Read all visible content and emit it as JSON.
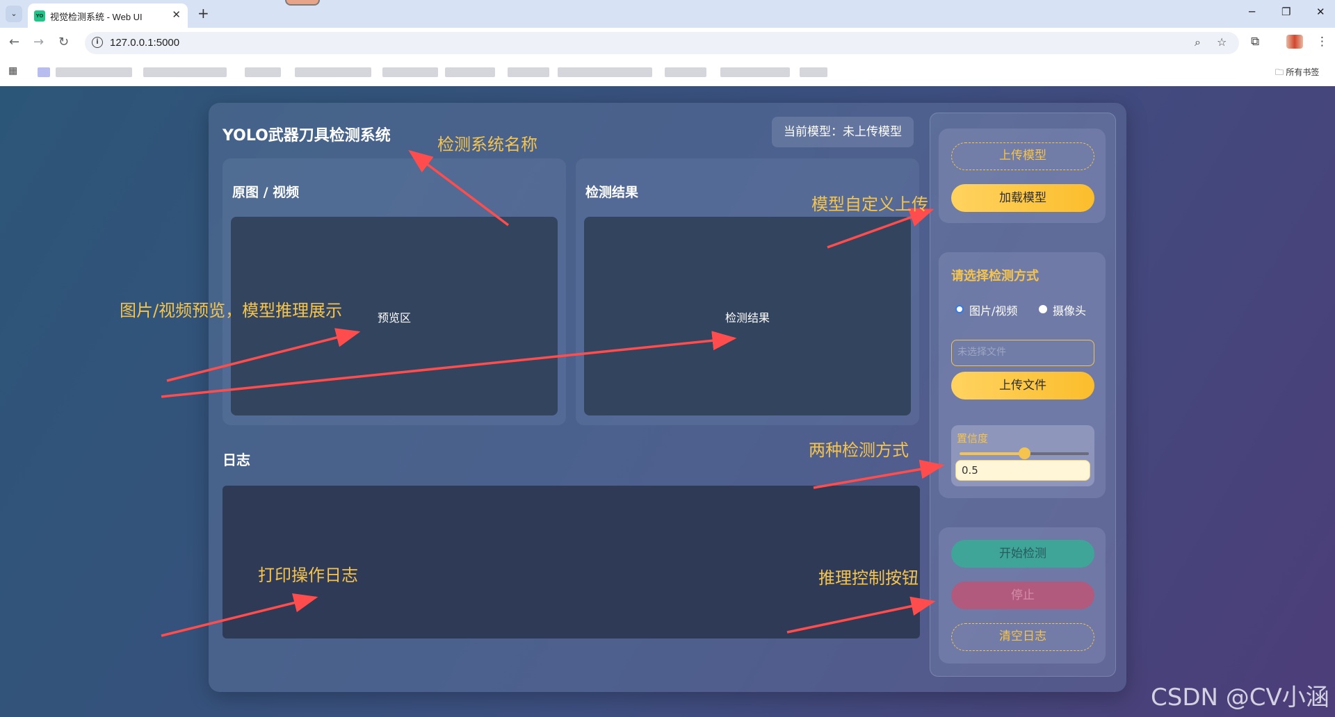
{
  "browser": {
    "tab_title": "视觉检测系统 - Web UI",
    "tab_favicon_text": "YO",
    "url": "127.0.0.1:5000",
    "bookmarks_folder": "所有书签"
  },
  "app": {
    "title": "YOLO武器刀具检测系统",
    "model_status": "当前模型：未上传模型",
    "preview_panel": {
      "title": "原图 / 视频",
      "placeholder": "预览区"
    },
    "result_panel": {
      "title": "检测结果",
      "placeholder": "检测结果"
    },
    "log_title": "日志",
    "sidebar": {
      "upload_model": "上传模型",
      "load_model": "加载模型",
      "mode_title": "请选择检测方式",
      "mode_options": [
        "图片/视频",
        "摄像头"
      ],
      "mode_selected": "图片/视频",
      "file_placeholder": "未选择文件",
      "upload_file": "上传文件",
      "confidence_label": "置信度",
      "confidence_value": "0.5",
      "confidence_fraction": 0.5,
      "start_detect": "开始检测",
      "stop": "停止",
      "clear_log": "清空日志"
    }
  },
  "annotations": {
    "system_name": "检测系统名称",
    "model_upload": "模型自定义上传",
    "preview": "图片/视频预览，模型推理展示",
    "modes": "两种检测方式",
    "log": "打印操作日志",
    "controls": "推理控制按钮"
  },
  "watermark": "CSDN @CV小涵",
  "colors": {
    "accent": "#f5c44e",
    "annotation": "#f5c44e",
    "arrow": "#ff4d4d",
    "start_button": "#3fa599",
    "stop_button": "#b15a7e"
  }
}
